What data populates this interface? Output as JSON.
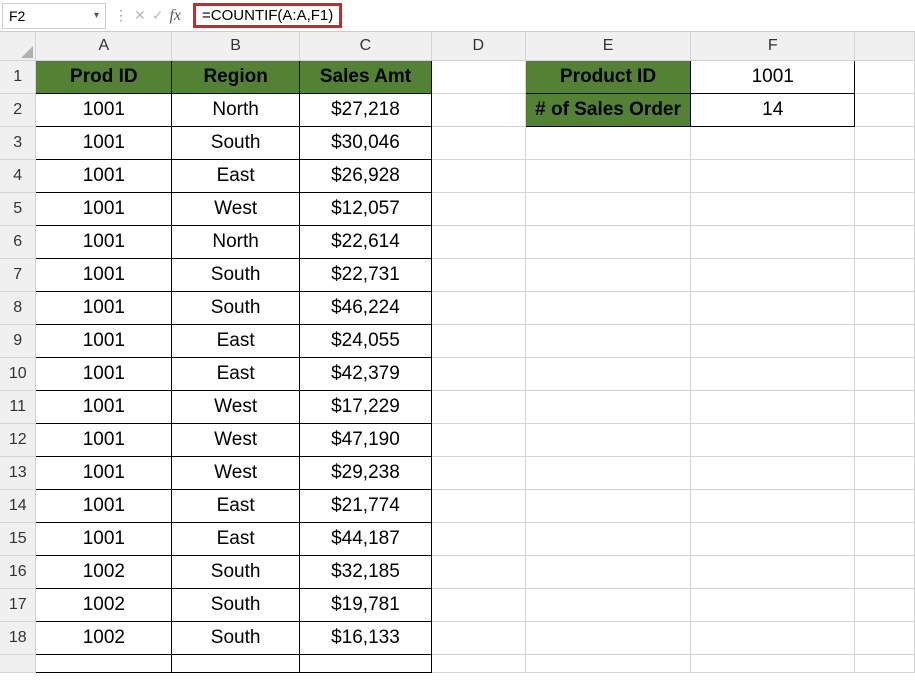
{
  "nameBox": {
    "value": "F2"
  },
  "formulaBar": {
    "cancelGlyph": "✕",
    "enterGlyph": "✓",
    "fx": "fx",
    "formula": "=COUNTIF(A:A,F1)"
  },
  "columns": [
    "A",
    "B",
    "C",
    "D",
    "E",
    "F"
  ],
  "mainHeaders": {
    "A": "Prod ID",
    "B": "Region",
    "C": "Sales Amt"
  },
  "sideHeaders": {
    "E1": "Product ID",
    "E2": "# of Sales Order"
  },
  "sideValues": {
    "F1": "1001",
    "F2": "14"
  },
  "rows": [
    {
      "r": 1
    },
    {
      "r": 2,
      "A": "1001",
      "B": "North",
      "C": "$27,218"
    },
    {
      "r": 3,
      "A": "1001",
      "B": "South",
      "C": "$30,046"
    },
    {
      "r": 4,
      "A": "1001",
      "B": "East",
      "C": "$26,928"
    },
    {
      "r": 5,
      "A": "1001",
      "B": "West",
      "C": "$12,057"
    },
    {
      "r": 6,
      "A": "1001",
      "B": "North",
      "C": "$22,614"
    },
    {
      "r": 7,
      "A": "1001",
      "B": "South",
      "C": "$22,731"
    },
    {
      "r": 8,
      "A": "1001",
      "B": "South",
      "C": "$46,224"
    },
    {
      "r": 9,
      "A": "1001",
      "B": "East",
      "C": "$24,055"
    },
    {
      "r": 10,
      "A": "1001",
      "B": "East",
      "C": "$42,379"
    },
    {
      "r": 11,
      "A": "1001",
      "B": "West",
      "C": "$17,229"
    },
    {
      "r": 12,
      "A": "1001",
      "B": "West",
      "C": "$47,190"
    },
    {
      "r": 13,
      "A": "1001",
      "B": "West",
      "C": "$29,238"
    },
    {
      "r": 14,
      "A": "1001",
      "B": "East",
      "C": "$21,774"
    },
    {
      "r": 15,
      "A": "1001",
      "B": "East",
      "C": "$44,187"
    },
    {
      "r": 16,
      "A": "1002",
      "B": "South",
      "C": "$32,185"
    },
    {
      "r": 17,
      "A": "1002",
      "B": "South",
      "C": "$19,781"
    },
    {
      "r": 18,
      "A": "1002",
      "B": "South",
      "C": "$16,133"
    }
  ]
}
